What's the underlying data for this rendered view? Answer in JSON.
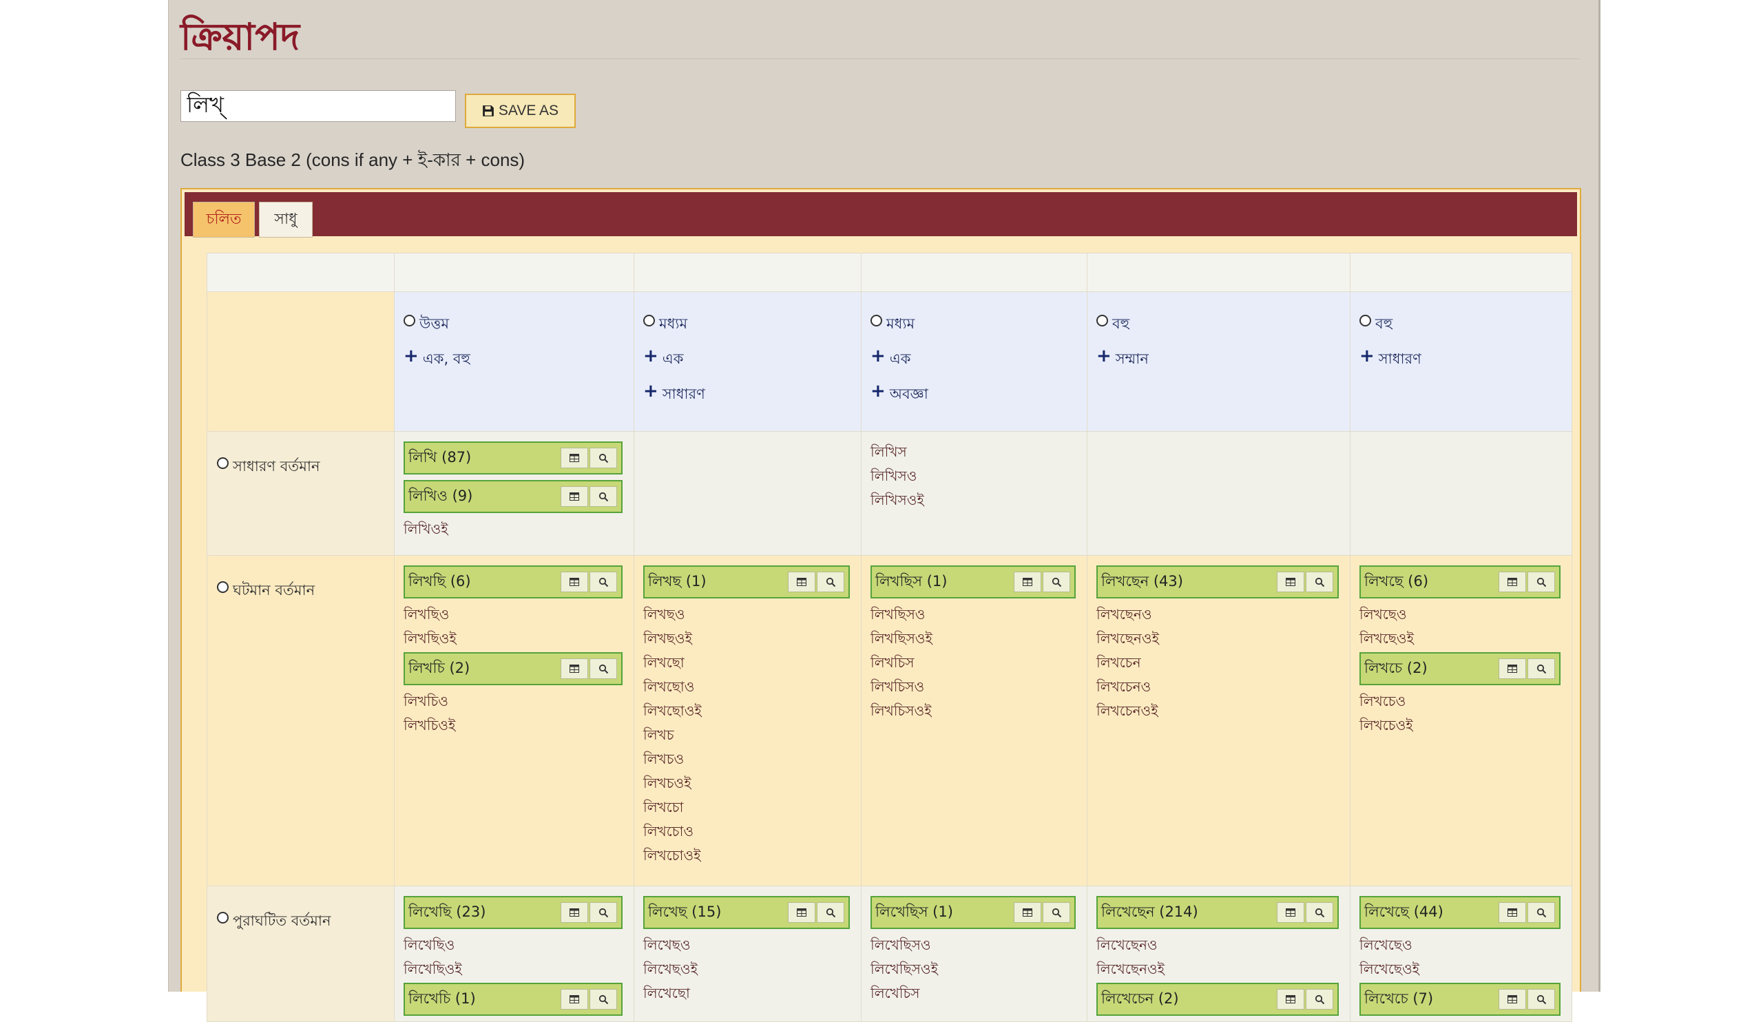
{
  "page": {
    "title": "ক্রিয়াপদ",
    "verb_value": "লিখ্",
    "save_label": "SAVE AS",
    "class_description": "Class 3 Base 2 (cons if any + ই-কার + cons)"
  },
  "tabs": [
    {
      "label": "চলিত",
      "active": true
    },
    {
      "label": "সাধু",
      "active": false
    }
  ],
  "columns": [
    {
      "person": "উত্তম",
      "qualifiers": [
        "এক, বহু"
      ]
    },
    {
      "person": "মধ্যম",
      "qualifiers": [
        "এক",
        "সাধারণ"
      ]
    },
    {
      "person": "মধ্যম",
      "qualifiers": [
        "এক",
        "অবজ্ঞা"
      ]
    },
    {
      "person": "বহু",
      "qualifiers": [
        "সম্মান"
      ]
    },
    {
      "person": "বহু",
      "qualifiers": [
        "সাধারণ"
      ]
    }
  ],
  "rows": [
    {
      "tense": "সাধারণ বর্তমান",
      "cells": [
        [
          {
            "type": "box",
            "text": "লিখি (87)"
          },
          {
            "type": "box",
            "text": "লিখিও (9)"
          },
          {
            "type": "variant",
            "text": "লিখিওই"
          }
        ],
        [],
        [
          {
            "type": "variant",
            "text": "লিখিস"
          },
          {
            "type": "variant",
            "text": "লিখিসও"
          },
          {
            "type": "variant",
            "text": "লিখিসওই"
          }
        ],
        [],
        []
      ]
    },
    {
      "tense": "ঘটমান বর্তমান",
      "cells": [
        [
          {
            "type": "box",
            "text": "লিখছি (6)"
          },
          {
            "type": "variant",
            "text": "লিখছিও"
          },
          {
            "type": "variant",
            "text": "লিখছিওই"
          },
          {
            "type": "box",
            "text": "লিখচি (2)"
          },
          {
            "type": "variant",
            "text": "লিখচিও"
          },
          {
            "type": "variant",
            "text": "লিখচিওই"
          }
        ],
        [
          {
            "type": "box",
            "text": "লিখছ (1)"
          },
          {
            "type": "variant",
            "text": "লিখছও"
          },
          {
            "type": "variant",
            "text": "লিখছওই"
          },
          {
            "type": "variant",
            "text": "লিখছো"
          },
          {
            "type": "variant",
            "text": "লিখছোও"
          },
          {
            "type": "variant",
            "text": "লিখছোওই"
          },
          {
            "type": "variant",
            "text": "লিখচ"
          },
          {
            "type": "variant",
            "text": "লিখচও"
          },
          {
            "type": "variant",
            "text": "লিখচওই"
          },
          {
            "type": "variant",
            "text": "লিখচো"
          },
          {
            "type": "variant",
            "text": "লিখচোও"
          },
          {
            "type": "variant",
            "text": "লিখচোওই"
          }
        ],
        [
          {
            "type": "box",
            "text": "লিখছিস (1)"
          },
          {
            "type": "variant",
            "text": "লিখছিসও"
          },
          {
            "type": "variant",
            "text": "লিখছিসওই"
          },
          {
            "type": "variant",
            "text": "লিখচিস"
          },
          {
            "type": "variant",
            "text": "লিখচিসও"
          },
          {
            "type": "variant",
            "text": "লিখচিসওই"
          }
        ],
        [
          {
            "type": "box",
            "text": "লিখছেন (43)"
          },
          {
            "type": "variant",
            "text": "লিখছেনও"
          },
          {
            "type": "variant",
            "text": "লিখছেনওই"
          },
          {
            "type": "variant",
            "text": "লিখচেন"
          },
          {
            "type": "variant",
            "text": "লিখচেনও"
          },
          {
            "type": "variant",
            "text": "লিখচেনওই"
          }
        ],
        [
          {
            "type": "box",
            "text": "লিখছে (6)"
          },
          {
            "type": "variant",
            "text": "লিখছেও"
          },
          {
            "type": "variant",
            "text": "লিখছেওই"
          },
          {
            "type": "box",
            "text": "লিখচে (2)"
          },
          {
            "type": "variant",
            "text": "লিখচেও"
          },
          {
            "type": "variant",
            "text": "লিখচেওই"
          }
        ]
      ]
    },
    {
      "tense": "পুরাঘটিত বর্তমান",
      "cells": [
        [
          {
            "type": "box",
            "text": "লিখেছি (23)"
          },
          {
            "type": "variant",
            "text": "লিখেছিও"
          },
          {
            "type": "variant",
            "text": "লিখেছিওই"
          },
          {
            "type": "box",
            "text": "লিখেচি (1)"
          }
        ],
        [
          {
            "type": "box",
            "text": "লিখেছ (15)"
          },
          {
            "type": "variant",
            "text": "লিখেছও"
          },
          {
            "type": "variant",
            "text": "লিখেছওই"
          },
          {
            "type": "variant",
            "text": "লিখেছো"
          }
        ],
        [
          {
            "type": "box",
            "text": "লিখেছিস (1)"
          },
          {
            "type": "variant",
            "text": "লিখেছিসও"
          },
          {
            "type": "variant",
            "text": "লিখেছিসওই"
          },
          {
            "type": "variant",
            "text": "লিখেচিস"
          }
        ],
        [
          {
            "type": "box",
            "text": "লিখেছেন (214)"
          },
          {
            "type": "variant",
            "text": "লিখেছেনও"
          },
          {
            "type": "variant",
            "text": "লিখেছেনওই"
          },
          {
            "type": "box",
            "text": "লিখেচেন (2)"
          }
        ],
        [
          {
            "type": "box",
            "text": "লিখেছে (44)"
          },
          {
            "type": "variant",
            "text": "লিখেছেও"
          },
          {
            "type": "variant",
            "text": "লিখেছেওই"
          },
          {
            "type": "box",
            "text": "লিখেচে (7)"
          }
        ]
      ]
    }
  ],
  "icons": {
    "save": "floppy-disk-icon",
    "table": "table-icon",
    "search": "search-icon",
    "person": "radio-icon",
    "qualifier": "plus-icon"
  },
  "colors": {
    "title": "#8a1a28",
    "tab_bar": "#832c33",
    "form_box": "#c7d877",
    "form_border": "#56a33a",
    "frame_border": "#e0a93c"
  }
}
